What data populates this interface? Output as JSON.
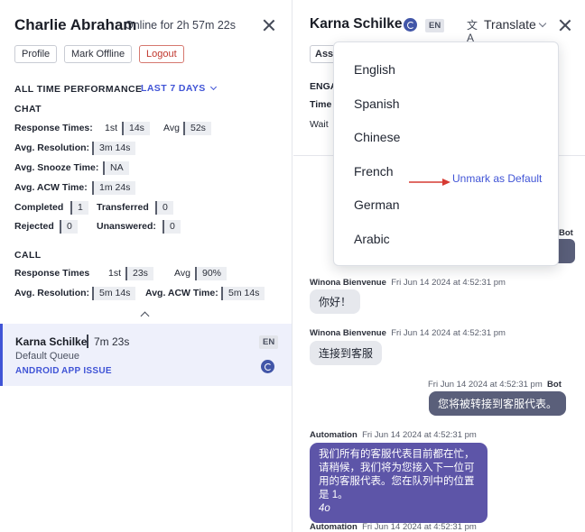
{
  "agent": {
    "name": "Charlie Abraham",
    "status": "Online for 2h 57m 22s",
    "buttons": {
      "profile": "Profile",
      "mark_offline": "Mark Offline",
      "logout": "Logout"
    }
  },
  "performance": {
    "heading": "ALL TIME PERFORMANCE",
    "period": "LAST 7 DAYS",
    "chat": {
      "heading": "CHAT",
      "response_times_label": "Response Times:",
      "first_label": "1st",
      "first_value": "14s",
      "avg_label": "Avg",
      "avg_value": "52s",
      "avg_resolution_label": "Avg. Resolution:",
      "avg_resolution_value": "3m 14s",
      "avg_snooze_label": "Avg. Snooze Time:",
      "avg_snooze_value": "NA",
      "avg_acw_label": "Avg. ACW Time:",
      "avg_acw_value": "1m 24s",
      "completed_label": "Completed",
      "completed_value": "1",
      "transferred_label": "Transferred",
      "transferred_value": "0",
      "rejected_label": "Rejected",
      "rejected_value": "0",
      "unanswered_label": "Unanswered:",
      "unanswered_value": "0"
    },
    "call": {
      "heading": "CALL",
      "response_times_label": "Response Times",
      "first_label": "1st",
      "first_value": "23s",
      "avg_label": "Avg",
      "avg_value": "90%",
      "avg_resolution_label": "Avg. Resolution:",
      "avg_resolution_value": "5m 14s",
      "avg_acw_label": "Avg. ACW Time:",
      "avg_acw_value": "5m 14s"
    }
  },
  "conversation": {
    "name": "Karna Schilke",
    "time": "7m 23s",
    "queue": "Default Queue",
    "lang": "EN",
    "tags": [
      "ANDROID",
      "APP ISSUE"
    ],
    "icon": "whatsapp-icon"
  },
  "chat_panel": {
    "customer_name": "Karna Schilke",
    "lang": "EN",
    "translate_label": "Translate",
    "background": {
      "assign_btn": "Ass",
      "engage_heading": "ENGA",
      "times_label": "Time",
      "wait_label": "Wait"
    },
    "languages": [
      "English",
      "Spanish",
      "Chinese",
      "French",
      "German",
      "Arabic"
    ],
    "unmark_default": "Unmark as Default",
    "partial_sender": "Bot",
    "messages": [
      {
        "sender": "Winona Bienvenue",
        "time": "Fri Jun 14 2024 at 4:52:31 pm",
        "text": "你好！"
      },
      {
        "sender": "Winona Bienvenue",
        "time": "Fri Jun 14 2024 at 4:52:31 pm",
        "text": "连接到客服"
      },
      {
        "sender": "Bot",
        "time": "Fri Jun 14 2024 at 4:52:31 pm",
        "text": "您将被转接到客服代表。"
      },
      {
        "sender": "Automation",
        "time": "Fri Jun 14 2024 at 4:52:31 pm",
        "text": "我们所有的客服代表目前都在忙，请稍候，我们将为您接入下一位可用的客服代表。您在队列中的位置是 1。",
        "text_tail": "4o"
      },
      {
        "sender": "Automation",
        "time": "Fri Jun 14 2024 at 4:52:31 pm"
      }
    ]
  },
  "colors": {
    "accent": "#4054d6",
    "logout": "#c0362c",
    "automation_bubble": "#5d55a8",
    "bot_bubble": "#5a5f7a",
    "arrow": "#d63a32"
  }
}
